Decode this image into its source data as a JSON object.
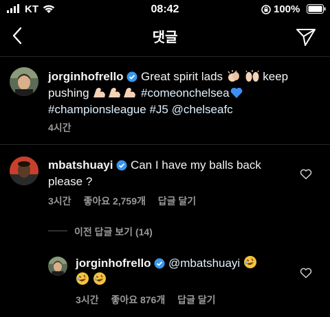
{
  "status": {
    "carrier": "KT",
    "time": "08:42",
    "battery": "100%"
  },
  "header": {
    "title": "댓글"
  },
  "caption": {
    "username": "jorginhofrello",
    "text1": "Great spirit lads",
    "text2": "keep",
    "text3": "pushing",
    "tag1": "#comeonchelsea",
    "tag2": "#championsleague",
    "tag3": "#J5",
    "tag4": "@chelseafc",
    "time": "4시간"
  },
  "comment1": {
    "username": "mbatshuayi",
    "text": "Can I have my balls back",
    "text2": "please ?",
    "time": "3시간",
    "likes": "좋아요 2,759개",
    "reply": "답글 달기"
  },
  "view_replies": "이전 답글 보기 (14)",
  "reply1": {
    "username": "jorginhofrello",
    "mention": "@mbatshuayi",
    "time": "3시간",
    "likes": "좋아요 876개",
    "reply": "답글 달기"
  },
  "colors": {
    "verified": "#3897f0",
    "heart_blue": "#3e8ef7",
    "muted": "#9a9a9a"
  }
}
